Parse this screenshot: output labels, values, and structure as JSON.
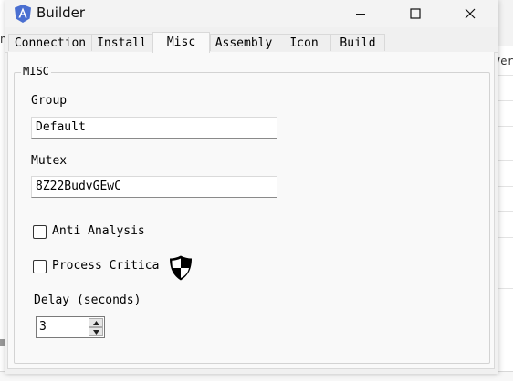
{
  "window": {
    "title": "Builder"
  },
  "background": {
    "right_text": "Ver",
    "left_text": "n"
  },
  "tabs": [
    {
      "label": "Connection"
    },
    {
      "label": "Install"
    },
    {
      "label": "Misc",
      "active": true
    },
    {
      "label": "Assembly"
    },
    {
      "label": "Icon"
    },
    {
      "label": "Build"
    }
  ],
  "misc": {
    "group_title": "MISC",
    "group": {
      "label": "Group",
      "value": "Default"
    },
    "mutex": {
      "label": "Mutex",
      "value": "8Z22BudvGEwC"
    },
    "anti_analysis": {
      "label": "Anti Analysis",
      "checked": false
    },
    "process_critical": {
      "label": "Process Critica",
      "checked": false,
      "icon": "shield-icon"
    },
    "delay": {
      "label": "Delay (seconds)",
      "value": "3"
    }
  },
  "colors": {
    "app_icon": "#4a6fd1",
    "shield": "#000000"
  }
}
